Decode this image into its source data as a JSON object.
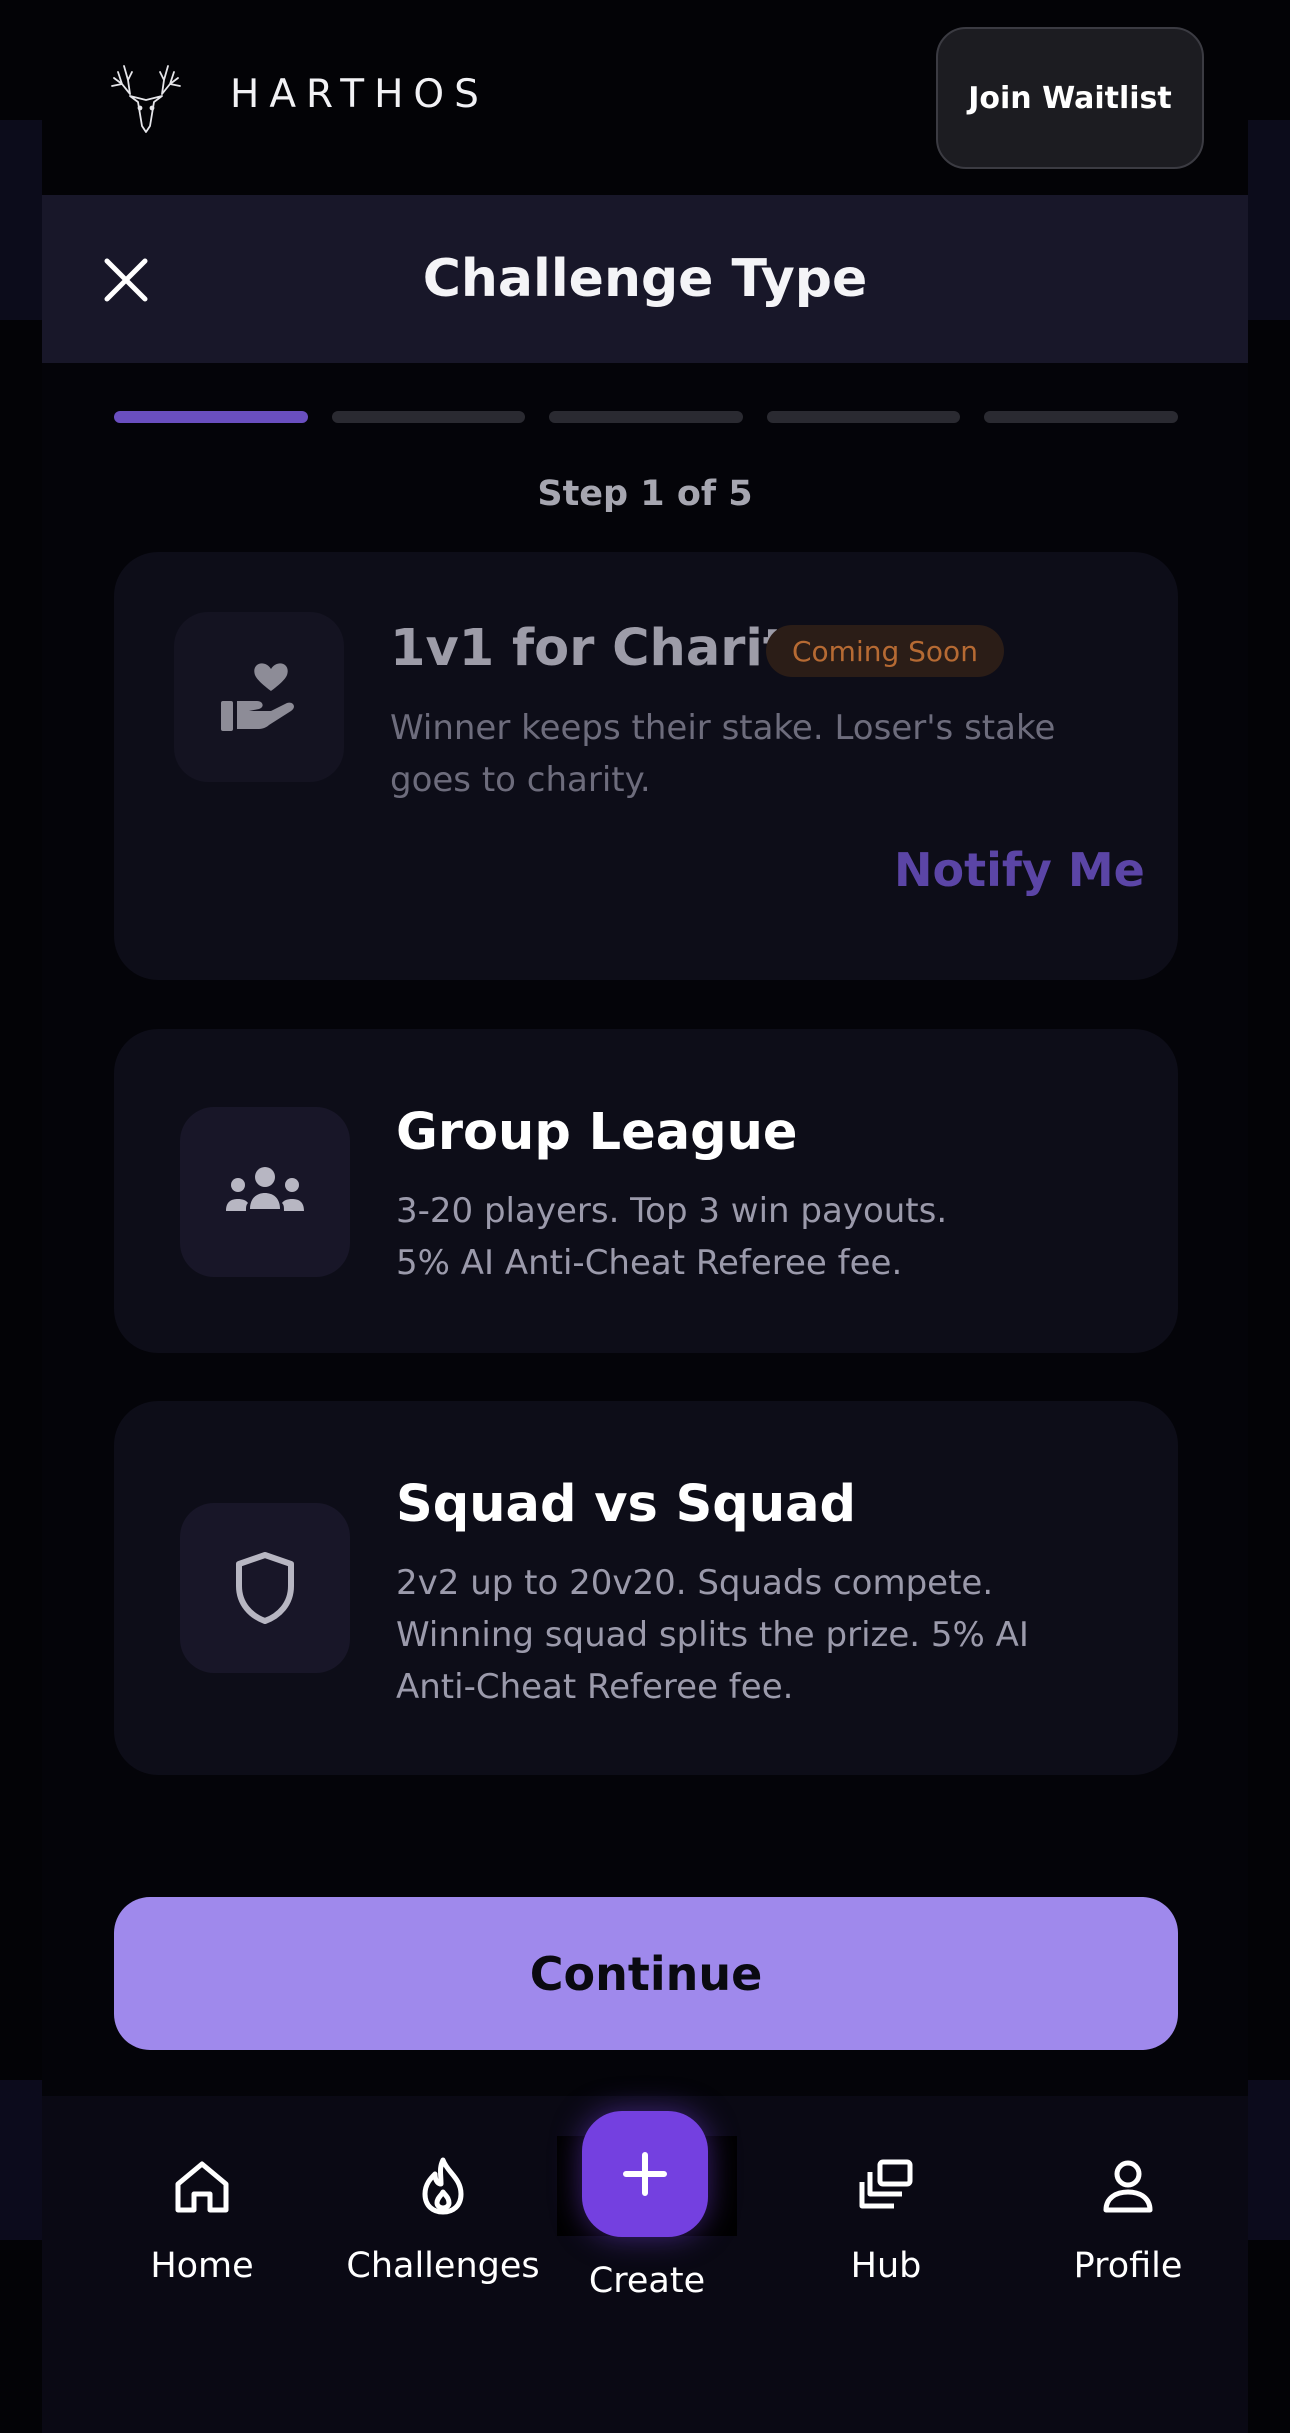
{
  "header": {
    "brand": "HARTHOS",
    "waitlist_label": "Join Waitlist"
  },
  "titlebar": {
    "title": "Challenge Type"
  },
  "progress": {
    "current_step": 1,
    "total_steps": 5,
    "step_label": "Step 1 of 5"
  },
  "cards": [
    {
      "title": "1v1 for Charity",
      "badge": "Coming Soon",
      "description": "Winner keeps their stake. Loser's stake goes to charity.",
      "action": "Notify Me",
      "icon": "hand-heart-icon"
    },
    {
      "title": "Group League",
      "description_lines": [
        "3-20 players. Top 3 win payouts.",
        "5% AI Anti-Cheat Referee fee."
      ],
      "icon": "group-icon"
    },
    {
      "title": "Squad vs Squad",
      "description": "2v2 up to 20v20. Squads compete. Winning squad splits the prize. 5% AI Anti-Cheat Referee fee.",
      "icon": "shield-icon"
    }
  ],
  "continue_label": "Continue",
  "nav": [
    {
      "label": "Home",
      "icon": "home-icon"
    },
    {
      "label": "Challenges",
      "icon": "flame-icon"
    },
    {
      "label": "Create",
      "icon": "plus-icon"
    },
    {
      "label": "Hub",
      "icon": "stack-icon"
    },
    {
      "label": "Profile",
      "icon": "person-icon"
    }
  ],
  "colors": {
    "accent": "#7440e0",
    "continue": "#9f89ec",
    "progress_active": "#6a4fc0",
    "badge_text": "#b66a33"
  }
}
